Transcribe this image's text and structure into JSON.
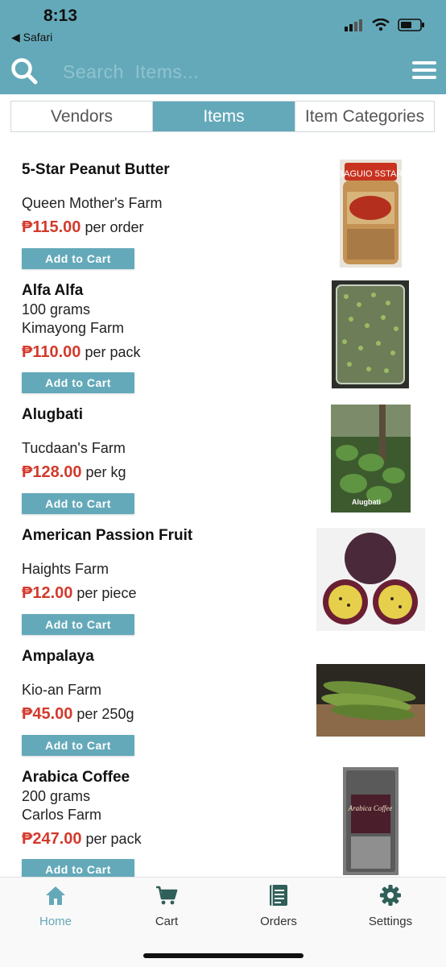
{
  "status_bar": {
    "time": "8:13",
    "back_app": "◀ Safari"
  },
  "search": {
    "placeholder": "Search  Items..."
  },
  "tabs": [
    {
      "label": "Vendors",
      "active": false
    },
    {
      "label": "Items",
      "active": true
    },
    {
      "label": "Item Categories",
      "active": false
    }
  ],
  "items": [
    {
      "name": "5-Star Peanut Butter",
      "size": "",
      "vendor": "Queen Mother's Farm",
      "price": "₱115.00",
      "unit": "per order",
      "button": "Add to Cart",
      "image": "peanut-butter-jar"
    },
    {
      "name": "Alfa Alfa",
      "size": "100 grams",
      "vendor": "Kimayong Farm",
      "price": "₱110.00",
      "unit": "per pack",
      "button": "Add to Cart",
      "image": "alfalfa-sprouts-tray"
    },
    {
      "name": "Alugbati",
      "size": "",
      "vendor": "Tucdaan's Farm",
      "price": "₱128.00",
      "unit": "per kg",
      "button": "Add to Cart",
      "image": "alugbati-plants",
      "image_caption": "Alugbati"
    },
    {
      "name": "American Passion Fruit",
      "size": "",
      "vendor": "Haights Farm",
      "price": "₱12.00",
      "unit": "per piece",
      "button": "Add to Cart",
      "image": "passion-fruit"
    },
    {
      "name": "Ampalaya",
      "size": "",
      "vendor": "Kio-an Farm",
      "price": "₱45.00",
      "unit": "per 250g",
      "button": "Add to Cart",
      "image": "bitter-gourd"
    },
    {
      "name": "Arabica Coffee",
      "size": "200 grams",
      "vendor": "Carlos Farm",
      "price": "₱247.00",
      "unit": "per pack",
      "button": "Add to Cart",
      "image": "coffee-bag",
      "image_caption": "Arabica Coffee"
    }
  ],
  "bottom_nav": [
    {
      "label": "Home",
      "icon": "home-icon",
      "active": true
    },
    {
      "label": "Cart",
      "icon": "cart-icon",
      "active": false
    },
    {
      "label": "Orders",
      "icon": "orders-icon",
      "active": false
    },
    {
      "label": "Settings",
      "icon": "settings-icon",
      "active": false
    }
  ],
  "colors": {
    "accent": "#64a9b9",
    "price": "#d33a2c",
    "active_nav": "#64a9b9"
  }
}
